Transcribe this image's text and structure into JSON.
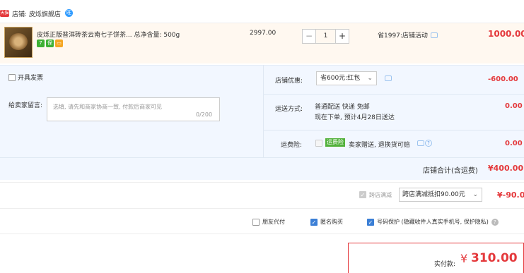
{
  "store": {
    "tag": "天猫",
    "name": "店铺: 皮烁旗舰店",
    "chat_badge": "旺"
  },
  "item": {
    "title": "皮烁正版普洱砖茶云南七子饼茶... 总净含量: 500g",
    "price": "2997.00",
    "quantity": "1",
    "minus": "−",
    "plus": "+",
    "promo": "省1997:店铺活动",
    "total": "1000.00"
  },
  "options": {
    "invoice_label": "开具发票",
    "message_label": "给卖家留言:",
    "message_placeholder": "选填, 请先和商家协商一致, 付款后商家可见",
    "message_count": "0/200",
    "coupon_label": "店铺优惠:",
    "coupon_value": "省600元:红包",
    "coupon_amount": "-600.00",
    "shipping_label": "运送方式:",
    "shipping_line1": "普通配送 快递 免邮",
    "shipping_line2": "现在下单, 预计4月28日送达",
    "shipping_amount": "0.00",
    "insurance_label": "运费险:",
    "insurance_badge": "运费险",
    "insurance_text": "卖家赠送, 退换货可赔",
    "insurance_amount": "0.00",
    "subtotal_label": "店铺合计(含运费)",
    "subtotal_value": "¥400.00"
  },
  "cross_store": {
    "label": "跨店满减",
    "select_value": "跨店满减抵扣90.00元",
    "amount": "¥-90.00"
  },
  "bottom_options": {
    "friend_pay": "朋友代付",
    "anonymous": "匿名购买",
    "number_protect": "号码保护 (隐藏收件人真实手机号, 保护隐私)"
  },
  "payment": {
    "label": "实付款:",
    "currency": "¥",
    "value": "310.00"
  },
  "colors": {
    "accent_red": "#e4393c",
    "option_bg": "#f2f7ff",
    "check_blue": "#3b7fd6"
  }
}
